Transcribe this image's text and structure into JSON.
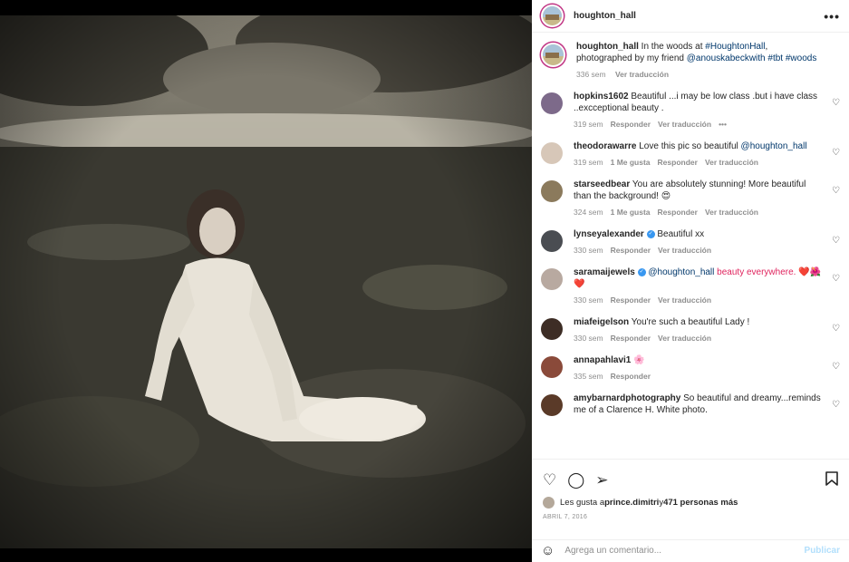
{
  "post": {
    "username": "houghton_hall",
    "more_label": "•••",
    "image_alt": "Vintage sepia photo of a woman in a white dress sitting on grass in the woods"
  },
  "caption": {
    "username": "houghton_hall",
    "text_a": "In the woods at ",
    "tag1": "#HoughtonHall",
    "text_b": ", photographed by my friend ",
    "tag2": "@anouskabeckwith",
    "tag3": " #tbt",
    "tag4": " #woods",
    "time": "336 sem",
    "translate": "Ver traducción"
  },
  "comments": [
    {
      "username": "hopkins1602",
      "text": "Beautiful ...i may be low class .but i have class ..excceptional beauty .",
      "time": "319 sem",
      "likes": "",
      "reply": "Responder",
      "translate": "Ver traducción",
      "more": "•••",
      "color": "#7d6a8a"
    },
    {
      "username": "theodorawarre",
      "text": "Love this pic so beautiful ",
      "mention": "@houghton_hall",
      "time": "319 sem",
      "likes": "1 Me gusta",
      "reply": "Responder",
      "translate": "Ver traducción",
      "color": "#d7c7b8"
    },
    {
      "username": "starseedbear",
      "text": "You are absolutely stunning! More beautiful than the background! 😍",
      "time": "324 sem",
      "likes": "1 Me gusta",
      "reply": "Responder",
      "translate": "Ver traducción",
      "color": "#8b7a5c"
    },
    {
      "username": "lynseyalexander",
      "verified": "✓",
      "text": "Beautiful xx",
      "time": "330 sem",
      "likes": "",
      "reply": "Responder",
      "translate": "Ver traducción",
      "color": "#4a4d52"
    },
    {
      "username": "saramaijewels",
      "verified": "✓",
      "mention": "@houghton_hall",
      "text": " beauty everywhere. ❤️🌺 ❤️",
      "time": "330 sem",
      "likes": "",
      "reply": "Responder",
      "translate": "Ver traducción",
      "color": "#b8a9a0"
    },
    {
      "username": "miafeigelson",
      "text": "You're such a beautiful Lady !",
      "time": "330 sem",
      "likes": "",
      "reply": "Responder",
      "translate": "Ver traducción",
      "color": "#3d2d25"
    },
    {
      "username": "annapahlavi1",
      "text": "🌸",
      "time": "335 sem",
      "likes": "",
      "reply": "Responder",
      "translate": "",
      "color": "#8a4a3a"
    },
    {
      "username": "amybarnardphotography",
      "text": "So beautiful and dreamy...reminds me of a Clarence H. White photo.",
      "time": "",
      "likes": "",
      "reply": "",
      "translate": "",
      "color": "#5a3a28"
    }
  ],
  "actions": {
    "like_icon": "heart-icon",
    "comment_icon": "comment-icon",
    "share_icon": "share-icon",
    "save_icon": "bookmark-icon"
  },
  "likes": {
    "prefix": "Les gusta a ",
    "user": "prince.dimitri",
    "mid": " y ",
    "count": "471 personas más"
  },
  "date": "ABRIL 7, 2016",
  "add_comment": {
    "placeholder": "Agrega un comentario...",
    "publish": "Publicar"
  }
}
